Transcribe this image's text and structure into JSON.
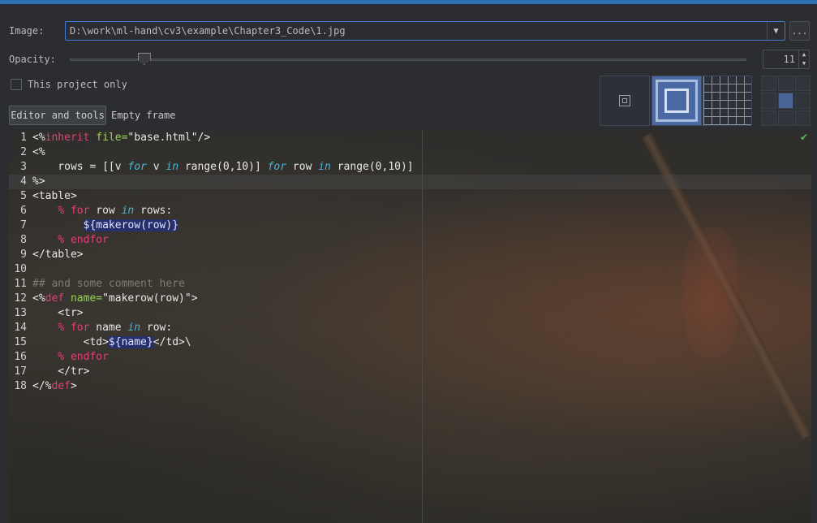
{
  "form": {
    "image_label": "Image:",
    "image_path": "D:\\work\\ml-hand\\cv3\\example\\Chapter3_Code\\1.jpg",
    "browse_label": "...",
    "opacity_label": "Opacity:",
    "opacity_value": "11",
    "opacity_fraction": 0.11,
    "project_only_label": "This project only",
    "project_only_checked": false
  },
  "tabs": [
    {
      "label": "Editor and tools",
      "active": true
    },
    {
      "label": "Empty frame",
      "active": false
    }
  ],
  "code": {
    "lines": [
      [
        {
          "t": "<%"
        },
        {
          "t": "inherit",
          "c": "kw"
        },
        {
          "t": " "
        },
        {
          "t": "file=",
          "c": "attr"
        },
        {
          "t": "\"base.html\""
        },
        {
          "t": "/>"
        }
      ],
      [
        {
          "t": "<%"
        }
      ],
      [
        {
          "t": "    rows = [[v "
        },
        {
          "t": "for",
          "c": "it"
        },
        {
          "t": " v "
        },
        {
          "t": "in",
          "c": "it"
        },
        {
          "t": " range(0,10)] "
        },
        {
          "t": "for",
          "c": "it"
        },
        {
          "t": " row "
        },
        {
          "t": "in",
          "c": "it"
        },
        {
          "t": " range(0,10)]"
        }
      ],
      [
        {
          "t": "%>"
        }
      ],
      [
        {
          "t": "<table>"
        }
      ],
      [
        {
          "t": "    "
        },
        {
          "t": "% for",
          "c": "kw"
        },
        {
          "t": " row "
        },
        {
          "t": "in",
          "c": "it"
        },
        {
          "t": " rows:"
        }
      ],
      [
        {
          "t": "        "
        },
        {
          "t": "${makerow(row)}",
          "c": "hl"
        }
      ],
      [
        {
          "t": "    "
        },
        {
          "t": "% endfor",
          "c": "kw"
        }
      ],
      [
        {
          "t": "</table>"
        }
      ],
      [],
      [
        {
          "t": "## and some comment here",
          "c": "cm"
        }
      ],
      [
        {
          "t": "<%"
        },
        {
          "t": "def",
          "c": "kw"
        },
        {
          "t": " "
        },
        {
          "t": "name=",
          "c": "attr"
        },
        {
          "t": "\"makerow(row)\""
        },
        {
          "t": ">"
        }
      ],
      [
        {
          "t": "    <tr>"
        }
      ],
      [
        {
          "t": "    "
        },
        {
          "t": "% for",
          "c": "kw"
        },
        {
          "t": " name "
        },
        {
          "t": "in",
          "c": "it"
        },
        {
          "t": " row:"
        }
      ],
      [
        {
          "t": "        <td>"
        },
        {
          "t": "${name}",
          "c": "hl"
        },
        {
          "t": "</td>\\"
        }
      ],
      [
        {
          "t": "    "
        },
        {
          "t": "% endfor",
          "c": "kw"
        }
      ],
      [
        {
          "t": "    </tr>"
        }
      ],
      [
        {
          "t": "</%"
        },
        {
          "t": "def",
          "c": "kw"
        },
        {
          "t": ">"
        }
      ]
    ]
  },
  "colors": {
    "accent": "#2a6fb0",
    "keyword": "#e0407a",
    "italic_keyword": "#48b6d8",
    "attribute": "#9bd35a",
    "comment": "#7d7d74"
  }
}
